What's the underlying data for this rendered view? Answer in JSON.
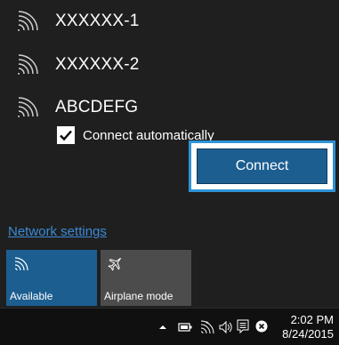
{
  "networks": [
    {
      "ssid": "XXXXXX-1",
      "icon": "wifi-signal-icon"
    },
    {
      "ssid": "XXXXXX-2",
      "icon": "wifi-signal-icon"
    },
    {
      "ssid": "ABCDEFG",
      "icon": "wifi-signal-icon"
    }
  ],
  "selected_network": {
    "connect_automatically_label": "Connect automatically",
    "connect_automatically_checked": true,
    "connect_button_label": "Connect"
  },
  "network_settings_link": "Network settings",
  "quick_actions": [
    {
      "label": "Available",
      "icon": "wifi-icon",
      "active": true
    },
    {
      "label": "Airplane mode",
      "icon": "airplane-icon",
      "active": false
    }
  ],
  "taskbar": {
    "tray_icons": [
      "chevron-up-icon",
      "battery-icon",
      "wifi-icon",
      "volume-icon",
      "action-center-icon",
      "close-circle-icon"
    ],
    "time": "2:02 PM",
    "date": "8/24/2015"
  },
  "colors": {
    "flyout_bg": "#1f1f1f",
    "accent": "#1d5e91",
    "link": "#3a8ad6",
    "highlight_frame": "#2e93d6",
    "tile_inactive": "#4c4c4c"
  }
}
